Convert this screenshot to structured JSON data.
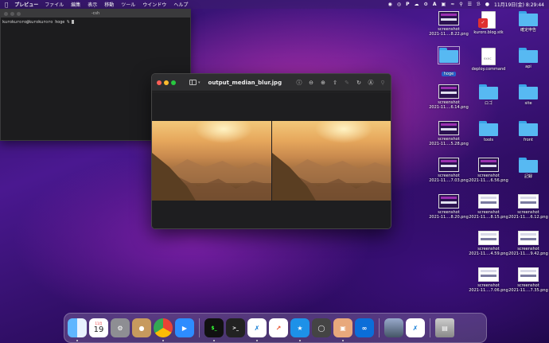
{
  "menubar": {
    "app_name": "プレビュー",
    "menus": [
      "ファイル",
      "編集",
      "表示",
      "移動",
      "ツール",
      "ウインドウ",
      "ヘルプ"
    ],
    "datetime": "11月19日(金)  8:29:44"
  },
  "terminal": {
    "title": "-csh",
    "prompt": "kurokuroro@kurokuroro hoge % "
  },
  "preview": {
    "title": "output_median_blur.jpg"
  },
  "desktop_icons": [
    {
      "type": "thumb",
      "line1": "screenshot",
      "line2": "2021-11....8.22.png"
    },
    {
      "type": "doc-red",
      "line1": "kuroro.blog.stk",
      "line2": ""
    },
    {
      "type": "folder",
      "line1": "確定申告",
      "line2": ""
    },
    {
      "type": "folder-selected",
      "line1": "hoge",
      "line2": ""
    },
    {
      "type": "doc",
      "line1": "deploy.command",
      "line2": ""
    },
    {
      "type": "folder",
      "line1": "api",
      "line2": ""
    },
    {
      "type": "thumb",
      "line1": "screenshot",
      "line2": "2021-11....6.14.png"
    },
    {
      "type": "folder",
      "line1": "ロゴ",
      "line2": ""
    },
    {
      "type": "folder",
      "line1": "site",
      "line2": ""
    },
    {
      "type": "thumb",
      "line1": "screenshot",
      "line2": "2021-11....5.28.png"
    },
    {
      "type": "folder",
      "line1": "tools",
      "line2": ""
    },
    {
      "type": "folder",
      "line1": "front",
      "line2": ""
    },
    {
      "type": "thumb",
      "line1": "screenshot",
      "line2": "2021-11....7.03.png"
    },
    {
      "type": "thumb",
      "line1": "screenshot",
      "line2": "2021-11....6.56.png"
    },
    {
      "type": "folder",
      "line1": "記録",
      "line2": ""
    },
    {
      "type": "thumb",
      "line1": "screenshot",
      "line2": "2021-11....8.20.png"
    },
    {
      "type": "thumb-light",
      "line1": "screenshot",
      "line2": "2021-11....8.15.png"
    },
    {
      "type": "thumb-light",
      "line1": "screenshot",
      "line2": "2021-11....6.12.png"
    },
    {
      "type": "thumb-light",
      "line1": "screenshot",
      "line2": "2021-11....4.59.png"
    },
    {
      "type": "thumb-light",
      "line1": "screenshot",
      "line2": "2021-11....9.42.png"
    },
    {
      "type": "thumb-light",
      "line1": "screenshot",
      "line2": "2021-11....7.06.png"
    },
    {
      "type": "thumb-light",
      "line1": "screenshot",
      "line2": "2021-11....7.35.png"
    }
  ],
  "dock": {
    "calendar_month": "11月",
    "calendar_day": "19"
  },
  "colors": {
    "accent": "#2a62d0",
    "folder": "#57b9f2"
  }
}
